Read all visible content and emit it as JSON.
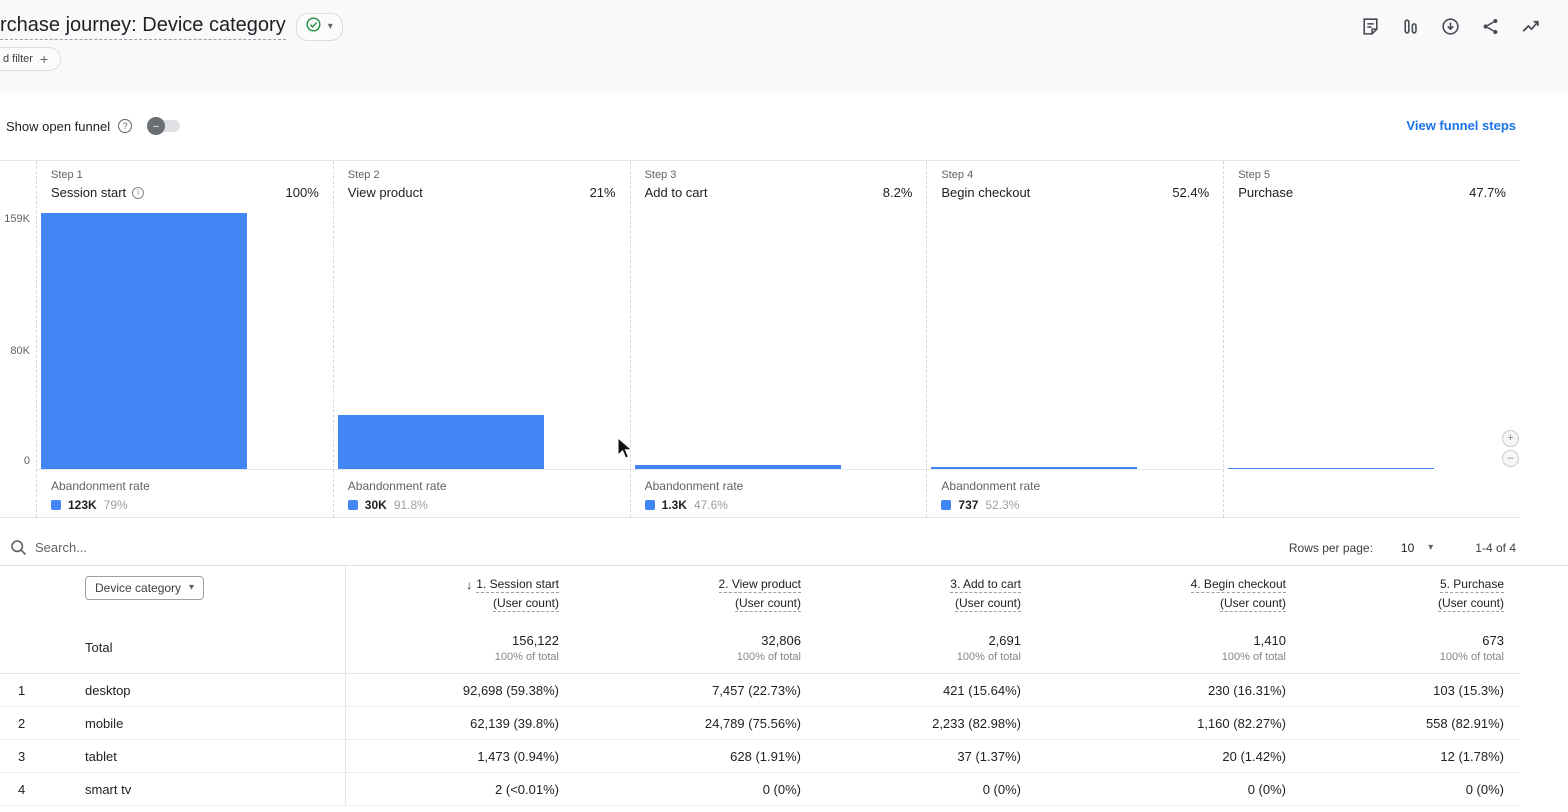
{
  "icons": {
    "caret": "▾",
    "help": "?",
    "info": "i",
    "plus": "+",
    "minus": "–",
    "sort_desc": "↓"
  },
  "colors": {
    "accent_blue": "#4285f4",
    "link_blue": "#1a73e8",
    "check_green": "#1e8e3e"
  },
  "header": {
    "title": "rchase journey: Device category"
  },
  "filter_chip": {
    "label": "d filter"
  },
  "controls": {
    "show_open_funnel": "Show open funnel",
    "view_funnel_steps": "View funnel steps"
  },
  "chart_data": {
    "type": "bar",
    "subtype": "funnel-steps",
    "y_ticks": [
      "159K",
      "80K",
      "0"
    ],
    "y_max": 159000,
    "bar_color": "#4285f4",
    "steps": [
      {
        "step_label": "Step 1",
        "name": "Session start",
        "pct": "100%",
        "value": 156122,
        "abandonment": {
          "label": "Abandonment rate",
          "count": "123K",
          "rate": "79%"
        }
      },
      {
        "step_label": "Step 2",
        "name": "View product",
        "pct": "21%",
        "value": 32806,
        "abandonment": {
          "label": "Abandonment rate",
          "count": "30K",
          "rate": "91.8%"
        }
      },
      {
        "step_label": "Step 3",
        "name": "Add to cart",
        "pct": "8.2%",
        "value": 2691,
        "abandonment": {
          "label": "Abandonment rate",
          "count": "1.3K",
          "rate": "47.6%"
        }
      },
      {
        "step_label": "Step 4",
        "name": "Begin checkout",
        "pct": "52.4%",
        "value": 1410,
        "abandonment": {
          "label": "Abandonment rate",
          "count": "737",
          "rate": "52.3%"
        }
      },
      {
        "step_label": "Step 5",
        "name": "Purchase",
        "pct": "47.7%",
        "value": 673
      }
    ]
  },
  "search": {
    "placeholder": "Search...",
    "rows_per_page_label": "Rows per page:",
    "rows_per_page_value": "10",
    "pagination": "1-4 of 4"
  },
  "table": {
    "dimension_header": "Device category",
    "columns": [
      {
        "title": "1. Session start",
        "subtitle": "(User count)"
      },
      {
        "title": "2. View product",
        "subtitle": "(User count)"
      },
      {
        "title": "3. Add to cart",
        "subtitle": "(User count)"
      },
      {
        "title": "4. Begin checkout",
        "subtitle": "(User count)"
      },
      {
        "title": "5. Purchase",
        "subtitle": "(User count)"
      }
    ],
    "total_row": {
      "label": "Total",
      "values": [
        "156,122",
        "32,806",
        "2,691",
        "1,410",
        "673"
      ],
      "subtext": "100% of total"
    },
    "rows": [
      {
        "index": "1",
        "dimension": "desktop",
        "values": [
          "92,698 (59.38%)",
          "7,457 (22.73%)",
          "421 (15.64%)",
          "230 (16.31%)",
          "103 (15.3%)"
        ]
      },
      {
        "index": "2",
        "dimension": "mobile",
        "values": [
          "62,139 (39.8%)",
          "24,789 (75.56%)",
          "2,233 (82.98%)",
          "1,160 (82.27%)",
          "558 (82.91%)"
        ]
      },
      {
        "index": "3",
        "dimension": "tablet",
        "values": [
          "1,473 (0.94%)",
          "628 (1.91%)",
          "37 (1.37%)",
          "20 (1.42%)",
          "12 (1.78%)"
        ]
      },
      {
        "index": "4",
        "dimension": "smart tv",
        "values": [
          "2 (<0.01%)",
          "0 (0%)",
          "0 (0%)",
          "0 (0%)",
          "0 (0%)"
        ]
      }
    ]
  }
}
